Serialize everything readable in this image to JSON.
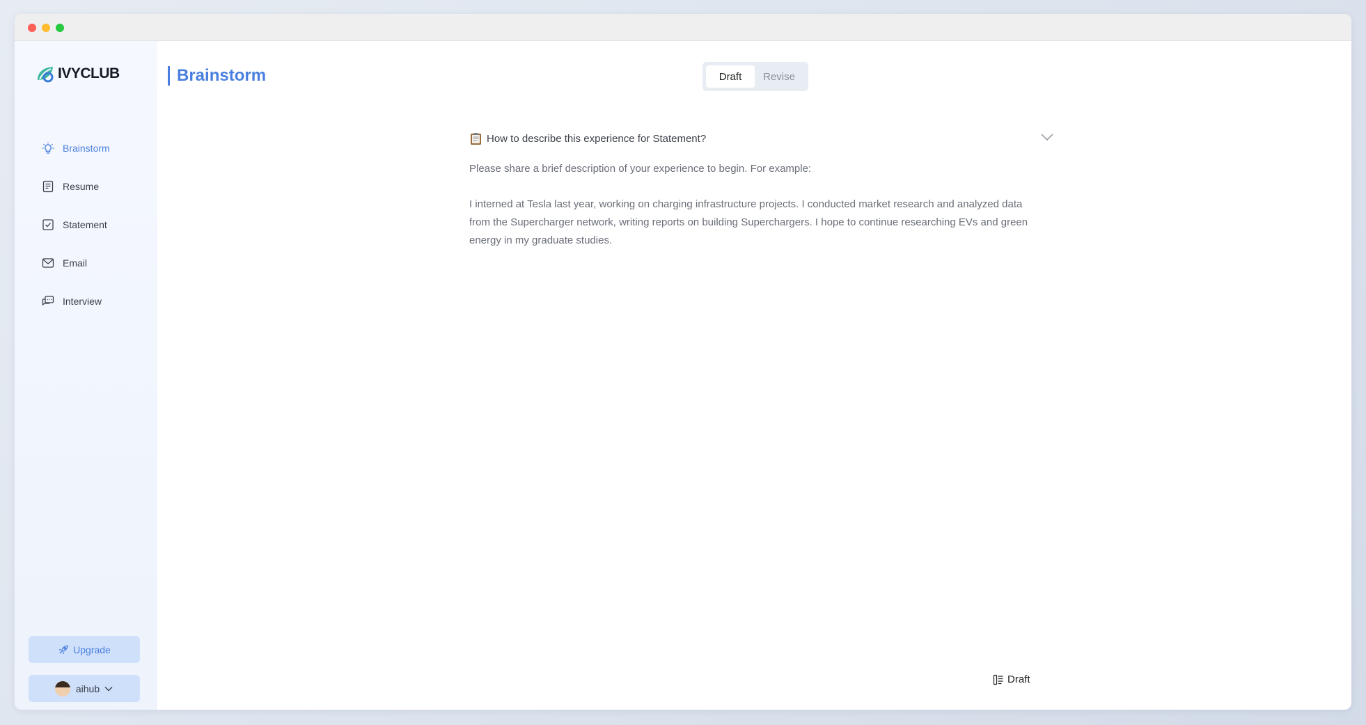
{
  "app": {
    "logo_text": "IVYCLUB"
  },
  "sidebar": {
    "items": [
      {
        "label": "Brainstorm",
        "icon": "lightbulb-icon",
        "active": true
      },
      {
        "label": "Resume",
        "icon": "document-icon"
      },
      {
        "label": "Statement",
        "icon": "checkbox-icon"
      },
      {
        "label": "Email",
        "icon": "mail-icon"
      },
      {
        "label": "Interview",
        "icon": "chat-icon"
      }
    ],
    "upgrade_label": "Upgrade",
    "user_name": "aihub"
  },
  "header": {
    "title": "Brainstorm",
    "mode_tabs": [
      {
        "label": "Draft",
        "active": true
      },
      {
        "label": "Revise",
        "active": false
      }
    ]
  },
  "main": {
    "question": "How to describe this experience for Statement?",
    "intro": "Please share a brief description of your experience to begin. For example:",
    "example": "I interned at Tesla last year, working on charging infrastructure projects. I conducted market research and analyzed data from the Supercharger network, writing reports on building Superchargers. I hope to continue researching EVs and green energy in my graduate studies."
  },
  "footer": {
    "draft_label": "Draft"
  },
  "colors": {
    "accent": "#4a7fe0",
    "button_bg": "#cfe0fb"
  }
}
